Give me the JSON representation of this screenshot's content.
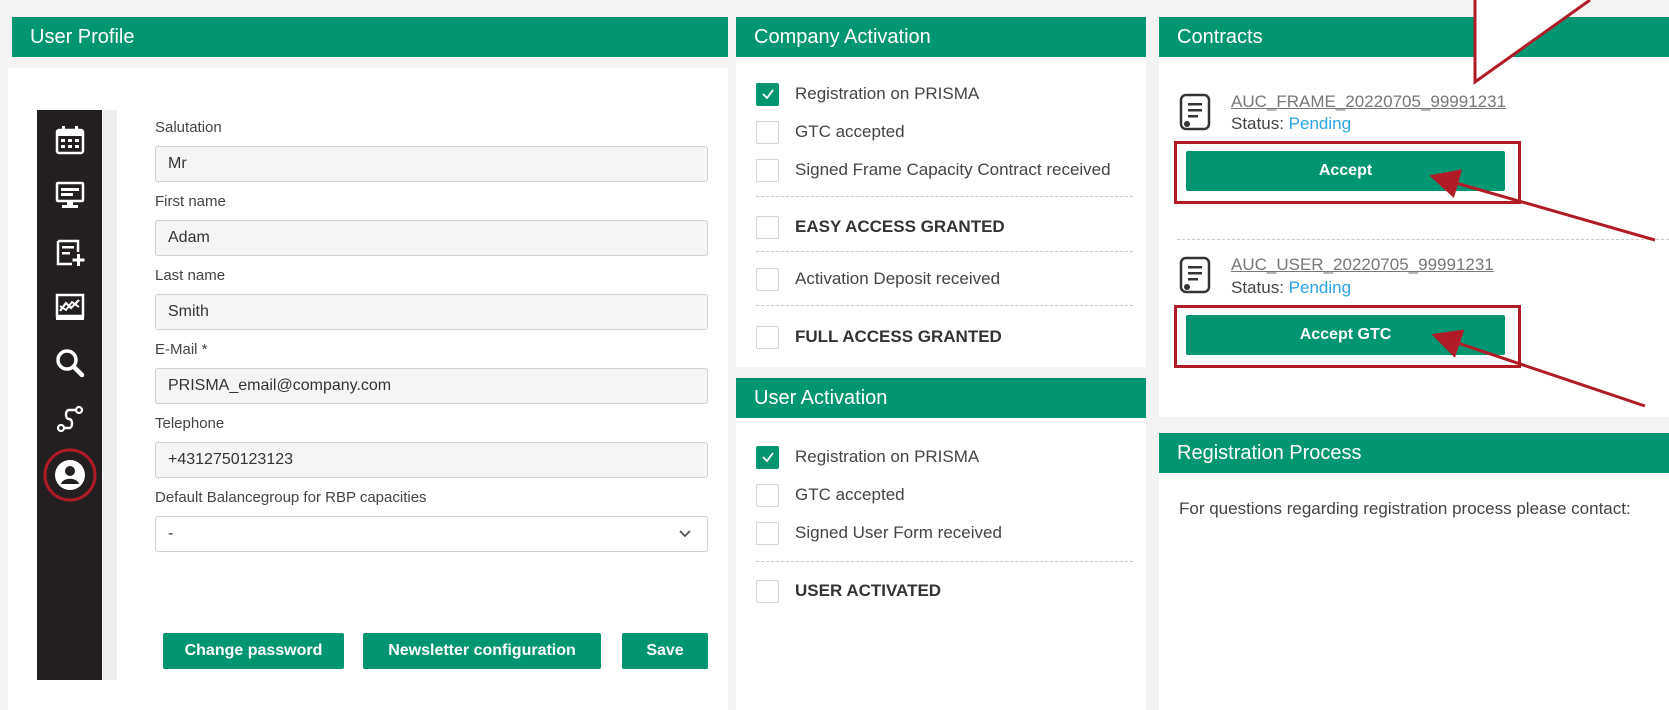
{
  "profile": {
    "title": "User Profile",
    "fields": [
      {
        "label": "Salutation",
        "value": "Mr"
      },
      {
        "label": "First name",
        "value": "Adam"
      },
      {
        "label": "Last name",
        "value": "Smith"
      },
      {
        "label": "E-Mail *",
        "value": "PRISMA_email@company.com"
      },
      {
        "label": "Telephone",
        "value": "+4312750123123"
      },
      {
        "label": "Default Balancegroup for RBP capacities",
        "value": "-"
      }
    ],
    "buttons": {
      "change_password": "Change password",
      "newsletter": "Newsletter configuration",
      "save": "Save"
    }
  },
  "sidebar": {
    "icons": [
      "calendar-icon",
      "monitor-icon",
      "add-list-icon",
      "chart-icon",
      "search-icon",
      "route-icon",
      "user-icon"
    ],
    "highlight_color": "#b11b25"
  },
  "company_activation": {
    "title": "Company Activation",
    "items": [
      {
        "label": "Registration on PRISMA",
        "checked": true
      },
      {
        "label": "GTC accepted",
        "checked": false
      },
      {
        "label": "Signed Frame Capacity Contract received",
        "checked": false
      },
      {
        "label": "EASY ACCESS GRANTED",
        "checked": false
      },
      {
        "label": "Activation Deposit received",
        "checked": false
      },
      {
        "label": "FULL ACCESS GRANTED",
        "checked": false
      }
    ]
  },
  "user_activation": {
    "title": "User Activation",
    "items": [
      {
        "label": "Registration on PRISMA",
        "checked": true
      },
      {
        "label": "GTC accepted",
        "checked": false
      },
      {
        "label": "Signed User Form received",
        "checked": false
      },
      {
        "label": "USER ACTIVATED",
        "checked": false
      }
    ]
  },
  "contracts": {
    "title": "Contracts",
    "status_label": "Status:",
    "items": [
      {
        "name": "AUC_FRAME_20220705_99991231",
        "status": "Pending",
        "button": "Accept"
      },
      {
        "name": "AUC_USER_20220705_99991231",
        "status": "Pending",
        "button": "Accept GTC"
      }
    ]
  },
  "registration": {
    "title": "Registration Process",
    "text": "For questions regarding registration process please contact:"
  },
  "colors": {
    "brand": "#009672",
    "link": "#2aa5e6",
    "annotation": "#b11b25"
  }
}
